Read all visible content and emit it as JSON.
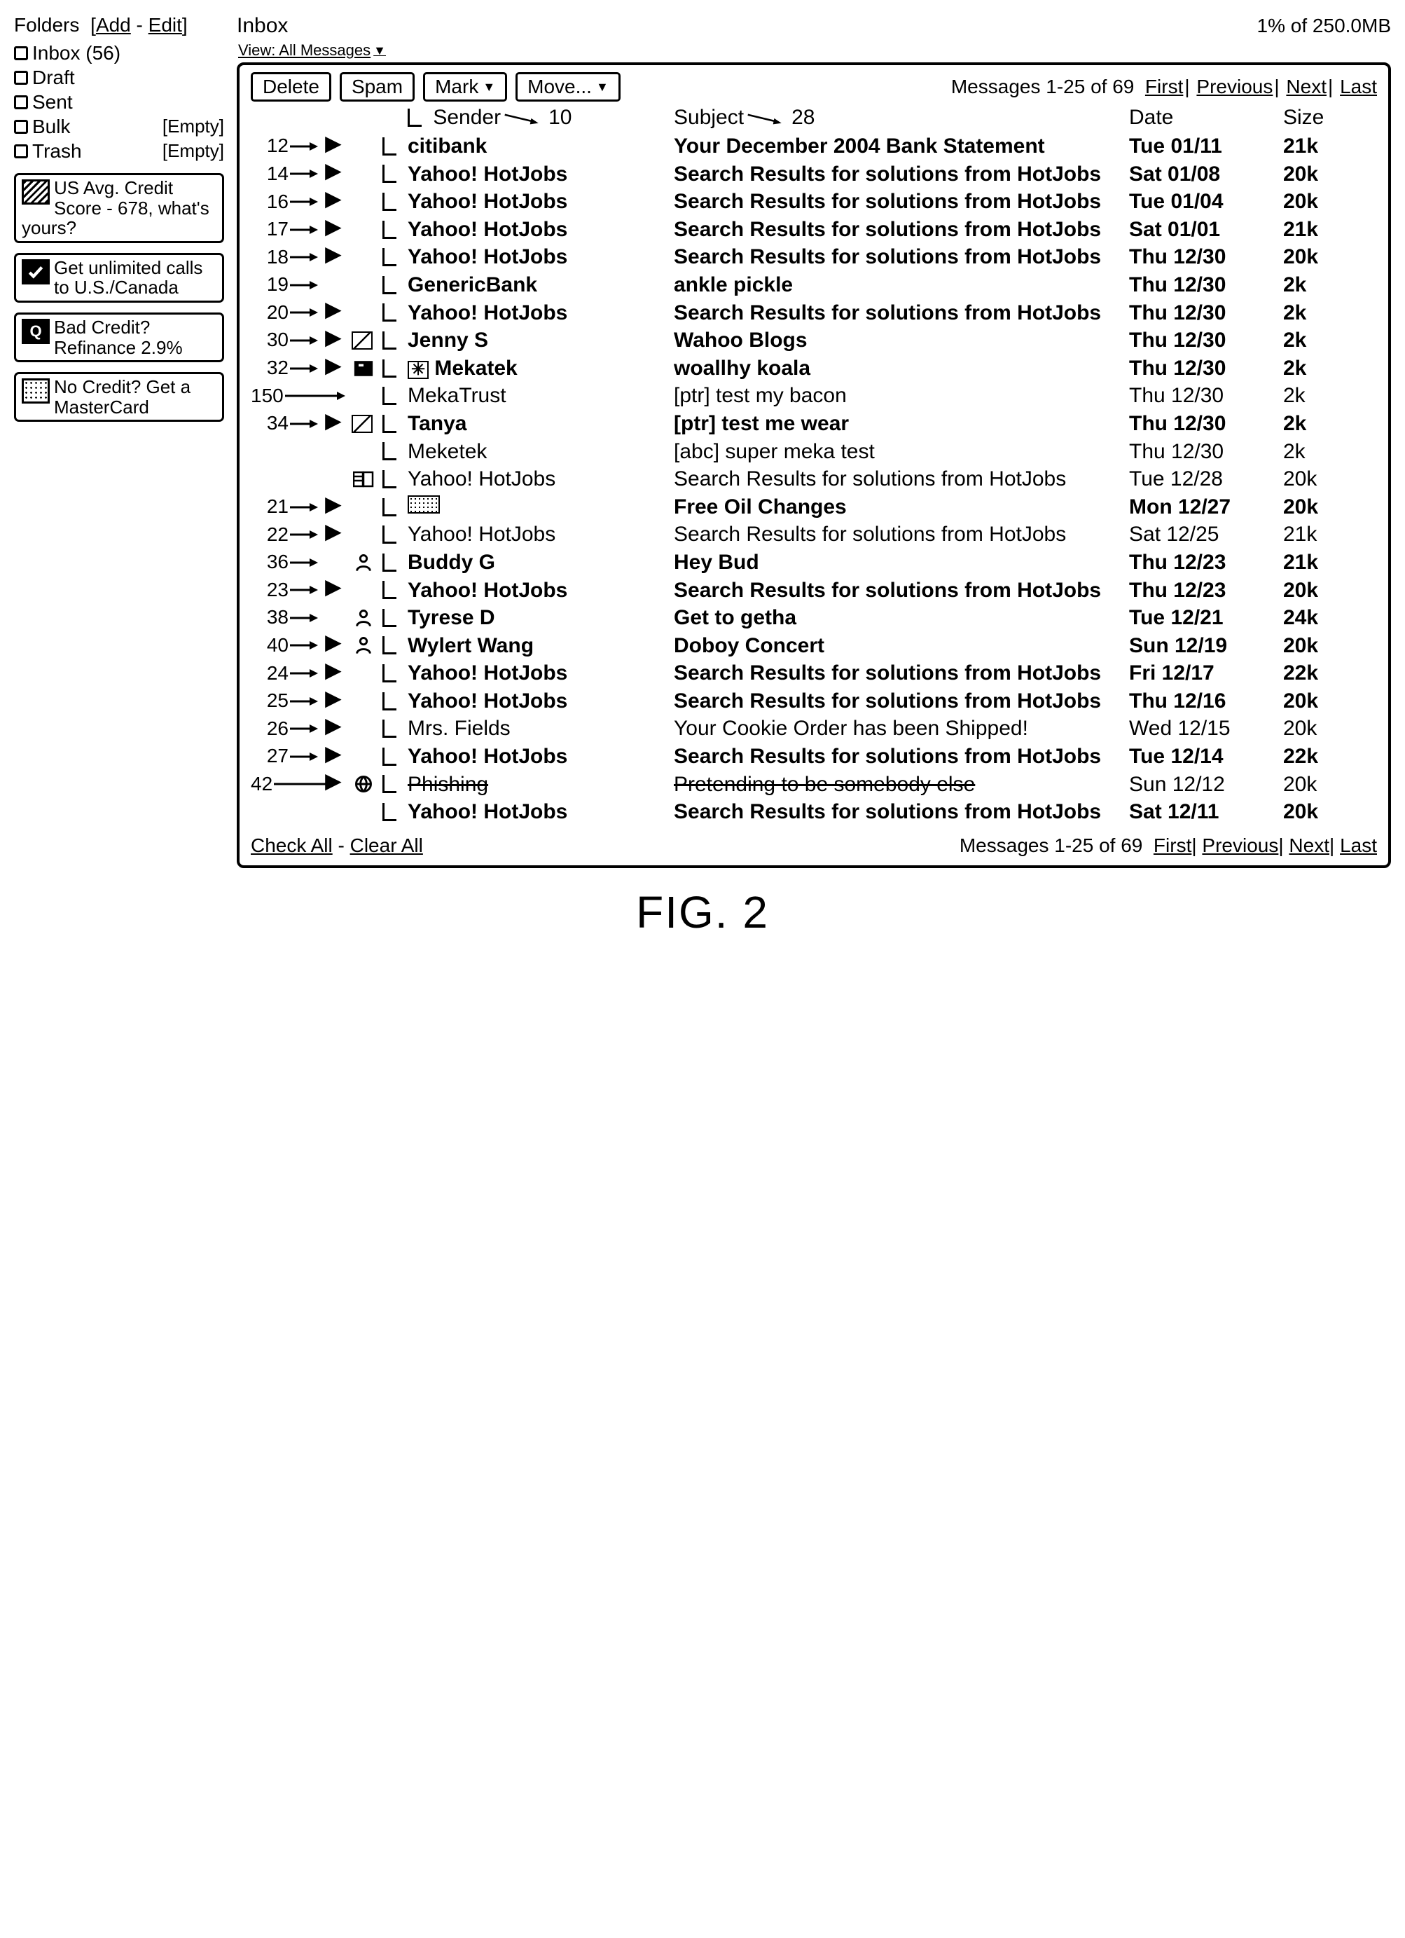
{
  "sidebar": {
    "header": "Folders",
    "add": "Add",
    "edit": "Edit",
    "folders": [
      {
        "name": "Inbox (56)",
        "empty": ""
      },
      {
        "name": "Draft",
        "empty": ""
      },
      {
        "name": "Sent",
        "empty": ""
      },
      {
        "name": "Bulk",
        "empty": "[Empty]"
      },
      {
        "name": "Trash",
        "empty": "[Empty]"
      }
    ],
    "ads": [
      {
        "icon": "hatch",
        "text": "US Avg. Credit Score - 678, what's yours?"
      },
      {
        "icon": "check",
        "text": "Get unlimited calls to U.S./Canada"
      },
      {
        "icon": "q",
        "text": "Bad Credit? Refinance 2.9%"
      },
      {
        "icon": "dots",
        "text": "No Credit? Get a MasterCard"
      }
    ]
  },
  "header": {
    "title": "Inbox",
    "view": "View: All Messages",
    "storage": "1% of 250.0MB"
  },
  "toolbar": {
    "delete": "Delete",
    "spam": "Spam",
    "mark": "Mark",
    "move": "Move..."
  },
  "pager": {
    "status": "Messages 1-25 of 69",
    "first": "First",
    "prev": "Previous",
    "next": "Next",
    "last": "Last"
  },
  "columns": {
    "sender": "Sender",
    "senderCallout": "10",
    "subject": "Subject",
    "subjectCallout": "28",
    "date": "Date",
    "size": "Size"
  },
  "rows": [
    {
      "callout": "12",
      "flag": true,
      "icon1": "",
      "icon2": "",
      "sender": "citibank",
      "subject": "Your December 2004 Bank Statement",
      "date": "Tue 01/11",
      "size": "21k",
      "bold": true
    },
    {
      "callout": "14",
      "flag": true,
      "icon1": "",
      "icon2": "",
      "sender": "Yahoo! HotJobs",
      "subject": "Search Results for solutions from HotJobs",
      "date": "Sat 01/08",
      "size": "20k",
      "bold": true
    },
    {
      "callout": "16",
      "flag": true,
      "icon1": "",
      "icon2": "",
      "sender": "Yahoo! HotJobs",
      "subject": "Search Results for solutions from HotJobs",
      "date": "Tue 01/04",
      "size": "20k",
      "bold": true
    },
    {
      "callout": "17",
      "flag": true,
      "icon1": "",
      "icon2": "",
      "sender": "Yahoo! HotJobs",
      "subject": "Search Results for solutions from HotJobs",
      "date": "Sat 01/01",
      "size": "21k",
      "bold": true
    },
    {
      "callout": "18",
      "flag": true,
      "icon1": "",
      "icon2": "",
      "sender": "Yahoo! HotJobs",
      "subject": "Search Results for solutions from HotJobs",
      "date": "Thu 12/30",
      "size": "20k",
      "bold": true
    },
    {
      "callout": "19",
      "flag": false,
      "icon1": "",
      "icon2": "",
      "sender": "GenericBank",
      "subject": "ankle pickle",
      "date": "Thu 12/30",
      "size": "2k",
      "bold": true
    },
    {
      "callout": "20",
      "flag": true,
      "icon1": "",
      "icon2": "",
      "sender": "Yahoo! HotJobs",
      "subject": "Search Results for solutions from HotJobs",
      "date": "Thu 12/30",
      "size": "2k",
      "bold": true
    },
    {
      "callout": "30",
      "flag": true,
      "icon1": "photo",
      "icon2": "",
      "sender": "Jenny S",
      "subject": "Wahoo Blogs",
      "date": "Thu 12/30",
      "size": "2k",
      "bold": true
    },
    {
      "callout": "32",
      "flag": true,
      "icon1": "attach",
      "icon2": "star",
      "sender": "Mekatek",
      "subject": "woallhy koala",
      "date": "Thu 12/30",
      "size": "2k",
      "bold": true
    },
    {
      "callout": "150",
      "flag": false,
      "icon1": "",
      "icon2": "",
      "sender": "MekaTrust",
      "subject": "[ptr] test my bacon",
      "date": "Thu 12/30",
      "size": "2k",
      "bold": false
    },
    {
      "callout": "34",
      "flag": true,
      "icon1": "photo",
      "icon2": "",
      "sender": "Tanya",
      "subject": "[ptr] test me wear",
      "date": "Thu 12/30",
      "size": "2k",
      "bold": true
    },
    {
      "callout": "",
      "flag": false,
      "icon1": "",
      "icon2": "",
      "sender": "Meketek",
      "subject": "[abc] super meka test",
      "date": "Thu 12/30",
      "size": "2k",
      "bold": false
    },
    {
      "callout": "",
      "flag": false,
      "icon1": "book",
      "icon2": "",
      "sender": "Yahoo! HotJobs",
      "subject": "Search Results for solutions from HotJobs",
      "date": "Tue 12/28",
      "size": "20k",
      "bold": false
    },
    {
      "callout": "21",
      "flag": true,
      "icon1": "",
      "icon2": "speckle",
      "sender": "",
      "subject": "Free Oil Changes",
      "date": "Mon 12/27",
      "size": "20k",
      "bold": true
    },
    {
      "callout": "22",
      "flag": true,
      "icon1": "",
      "icon2": "",
      "sender": "Yahoo! HotJobs",
      "subject": "Search Results for solutions from HotJobs",
      "date": "Sat 12/25",
      "size": "21k",
      "bold": false
    },
    {
      "callout": "36",
      "flag": false,
      "icon1": "person",
      "icon2": "",
      "sender": "Buddy G",
      "subject": "Hey Bud",
      "date": "Thu 12/23",
      "size": "21k",
      "bold": true
    },
    {
      "callout": "23",
      "flag": true,
      "icon1": "",
      "icon2": "",
      "sender": "Yahoo! HotJobs",
      "subject": "Search Results for solutions from HotJobs",
      "date": "Thu 12/23",
      "size": "20k",
      "bold": true
    },
    {
      "callout": "38",
      "flag": false,
      "icon1": "person",
      "icon2": "",
      "sender": "Tyrese D",
      "subject": "Get to getha",
      "date": "Tue 12/21",
      "size": "24k",
      "bold": true
    },
    {
      "callout": "40",
      "flag": true,
      "icon1": "person",
      "icon2": "",
      "sender": "Wylert Wang",
      "subject": "Doboy Concert",
      "date": "Sun 12/19",
      "size": "20k",
      "bold": true
    },
    {
      "callout": "24",
      "flag": true,
      "icon1": "",
      "icon2": "",
      "sender": "Yahoo! HotJobs",
      "subject": "Search Results for solutions from HotJobs",
      "date": "Fri 12/17",
      "size": "22k",
      "bold": true
    },
    {
      "callout": "25",
      "flag": true,
      "icon1": "",
      "icon2": "",
      "sender": "Yahoo! HotJobs",
      "subject": "Search Results for solutions from HotJobs",
      "date": "Thu 12/16",
      "size": "20k",
      "bold": true
    },
    {
      "callout": "26",
      "flag": true,
      "icon1": "",
      "icon2": "",
      "sender": "Mrs. Fields",
      "subject": "Your Cookie Order has been Shipped!",
      "date": "Wed 12/15",
      "size": "20k",
      "bold": false
    },
    {
      "callout": "27",
      "flag": true,
      "icon1": "",
      "icon2": "",
      "sender": "Yahoo! HotJobs",
      "subject": "Search Results for solutions from HotJobs",
      "date": "Tue 12/14",
      "size": "22k",
      "bold": true
    },
    {
      "callout": "42",
      "flag": true,
      "icon1": "globe",
      "icon2": "",
      "sender": "Phishing",
      "subject": "Pretending to be somebody else",
      "date": "Sun 12/12",
      "size": "20k",
      "bold": false,
      "strike": true
    },
    {
      "callout": "",
      "flag": false,
      "icon1": "",
      "icon2": "",
      "sender": "Yahoo! HotJobs",
      "subject": "Search Results for solutions from HotJobs",
      "date": "Sat 12/11",
      "size": "20k",
      "bold": true
    }
  ],
  "footer": {
    "check_all": "Check All",
    "clear_all": "Clear All"
  },
  "caption": "FIG. 2"
}
